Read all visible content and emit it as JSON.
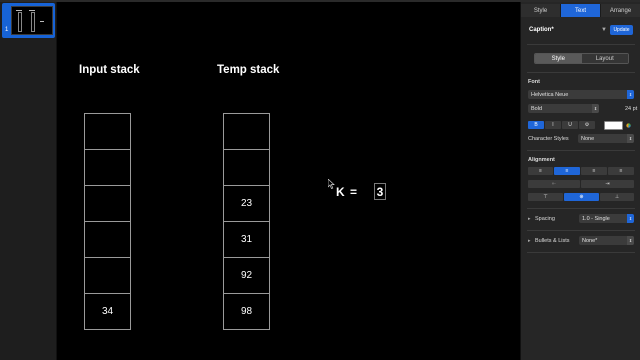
{
  "inspector": {
    "tabs": [
      "Style",
      "Text",
      "Arrange"
    ],
    "active_tab": "Text",
    "paragraph_style": "Caption*",
    "update_label": "Update",
    "segments": [
      "Style",
      "Layout"
    ],
    "font_section": "Font",
    "font_family": "Helvetica Neue",
    "font_weight": "Bold",
    "font_size": "24 pt",
    "format_buttons": [
      "B",
      "I",
      "U",
      "⚙"
    ],
    "character_styles_label": "Character Styles",
    "character_styles_value": "None",
    "alignment_label": "Alignment",
    "spacing_label": "Spacing",
    "spacing_value": "1.0 - Single",
    "bullets_label": "Bullets & Lists",
    "bullets_value": "None*",
    "accent_color": "#1f66d8"
  },
  "navigator": {
    "slide_number": "1"
  },
  "slide": {
    "input_stack_title": "Input stack",
    "temp_stack_title": "Temp stack",
    "input_stack": [
      "",
      "",
      "",
      "",
      "",
      "34"
    ],
    "temp_stack": [
      "",
      "",
      "23",
      "31",
      "92",
      "98"
    ],
    "k_label": "K",
    "k_equals": "=",
    "k_value": "3"
  }
}
